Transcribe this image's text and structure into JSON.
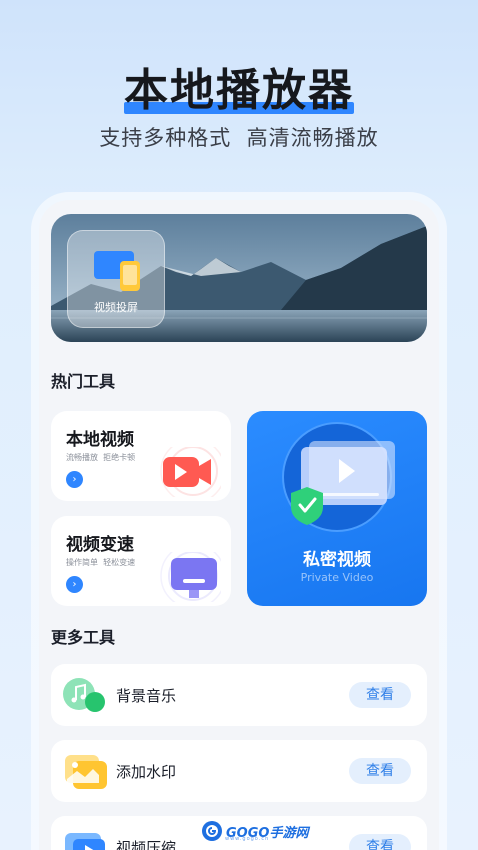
{
  "hero": {
    "title": "本地播放器",
    "subtitle": "支持多种格式  高清流畅播放"
  },
  "banner": {
    "cast_label": "视频投屏"
  },
  "hot_tools": {
    "title": "热门工具",
    "local_video": {
      "title": "本地视频",
      "desc": "流畅播放  拒绝卡顿"
    },
    "speed": {
      "title": "视频变速",
      "desc": "操作简单  轻松变速"
    },
    "private": {
      "title": "私密视频",
      "subtitle": "Private Video"
    }
  },
  "more_tools": {
    "title": "更多工具",
    "items": [
      {
        "label": "背景音乐",
        "action": "查看"
      },
      {
        "label": "添加水印",
        "action": "查看"
      },
      {
        "label": "视频压缩",
        "action": "查看"
      }
    ]
  },
  "watermark": {
    "brand": "GOGO手游网",
    "url": "www.gogo.cn"
  },
  "colors": {
    "accent": "#2f86ff",
    "page_bg": "#dfeefd",
    "card_bg": "#ffffff"
  }
}
